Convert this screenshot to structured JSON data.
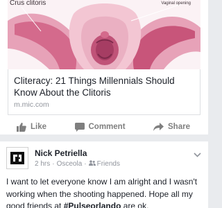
{
  "shared_link": {
    "image_labels": {
      "left": "Crus clitoris",
      "right": "Vaginal opening"
    },
    "title": "Cliteracy: 21 Things Millennials Should Know About the Clitoris",
    "domain": "m.mic.com"
  },
  "actions": {
    "like": "Like",
    "comment": "Comment",
    "share": "Share"
  },
  "post": {
    "author": "Nick Petriella",
    "time": "2 hrs",
    "location": "Osceola",
    "audience": "Friends",
    "separator": "·",
    "body_before": "I want to let everyone know I am alright and I wasn't working when the shooting happened. Hope all my good friends at ",
    "hashtag": "#Pulseorlando",
    "body_after": " are ok."
  },
  "colors": {
    "feed_background": "#e9ebee",
    "action_gray": "#7f7f7f",
    "meta_gray": "#90949c",
    "text": "#1d2129",
    "illustration_pink": "#d46a8c"
  },
  "icons": {
    "like": "thumbs-up-icon",
    "comment": "speech-bubble-icon",
    "share": "share-arrow-icon",
    "audience": "friends-icon",
    "menu": "chevron-down-icon"
  }
}
